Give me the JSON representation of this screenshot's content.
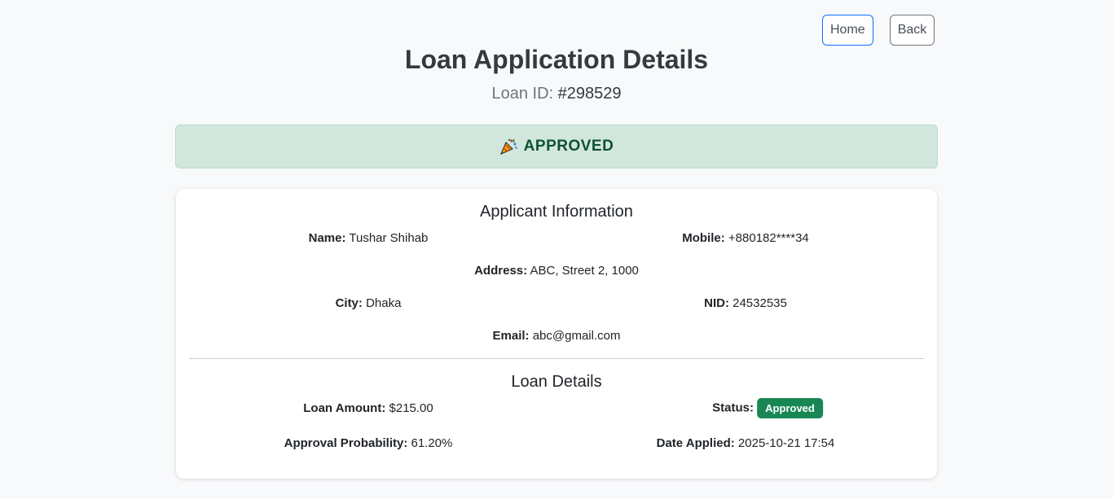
{
  "nav": {
    "home_label": "Home",
    "back_label": "Back"
  },
  "header": {
    "title": "Loan Application Details",
    "loan_id_label": "Loan ID:",
    "loan_id_value": "#298529"
  },
  "status_alert": {
    "icon": "party-popper-icon",
    "text": "APPROVED"
  },
  "applicant": {
    "title": "Applicant Information",
    "name_label": "Name:",
    "name_value": "Tushar Shihab",
    "mobile_label": "Mobile:",
    "mobile_value": "+880182****34",
    "address_label": "Address:",
    "address_value": "ABC, Street 2, 1000",
    "city_label": "City:",
    "city_value": "Dhaka",
    "nid_label": "NID:",
    "nid_value": "24532535",
    "email_label": "Email:",
    "email_value": "abc@gmail.com"
  },
  "loan": {
    "title": "Loan Details",
    "amount_label": "Loan Amount:",
    "amount_value": "$215.00",
    "status_label": "Status:",
    "status_badge": "Approved",
    "probability_label": "Approval Probability:",
    "probability_value": "61.20%",
    "date_label": "Date Applied:",
    "date_value": "2025-10-21 17:54"
  },
  "colors": {
    "success": "#198754",
    "alert_bg": "#d1e7dd",
    "alert_text": "#0f5132",
    "primary": "#0d6efd"
  }
}
